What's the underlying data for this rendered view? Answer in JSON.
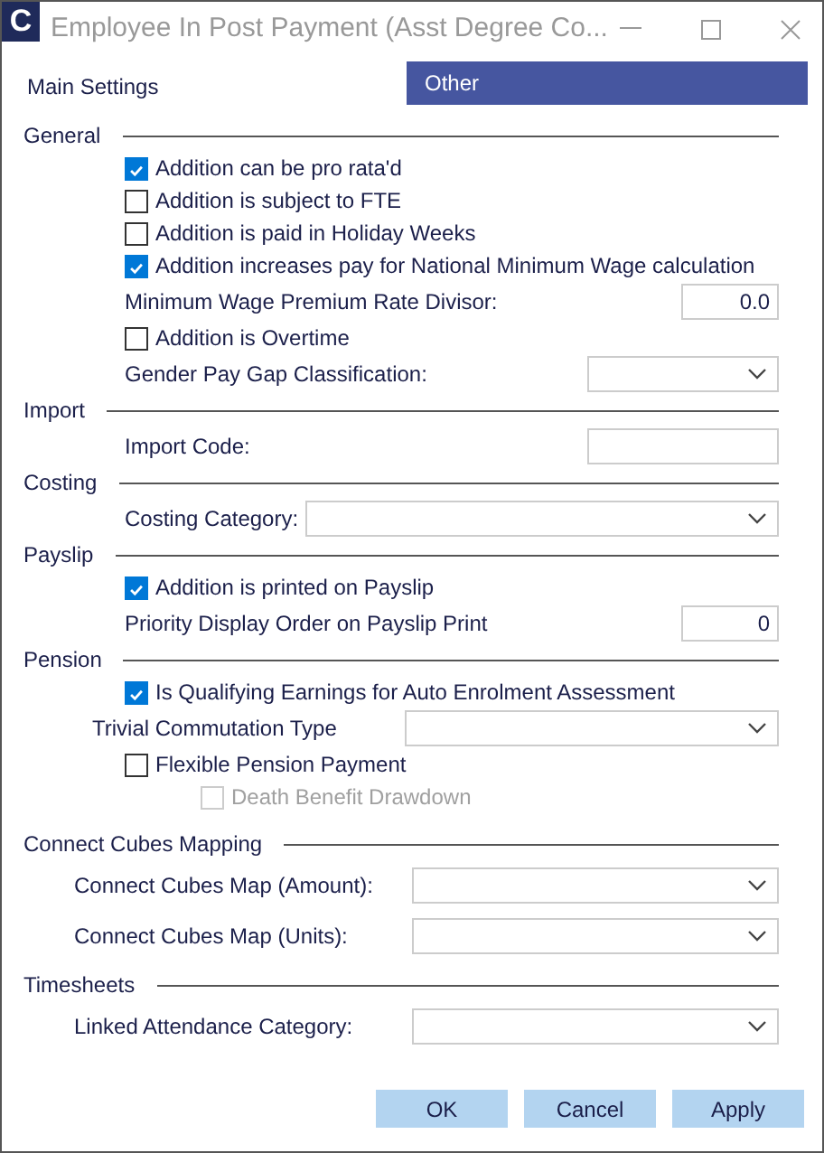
{
  "window": {
    "app_icon": "C",
    "title": "Employee In Post Payment (Asst Degree Co..."
  },
  "tabs": [
    {
      "label": "Main Settings",
      "selected": false
    },
    {
      "label": "Other",
      "selected": true
    }
  ],
  "sections": [
    {
      "title": "General",
      "rows": [
        {
          "kind": "checkbox",
          "label": "Addition can be pro rata'd",
          "checked": true,
          "disabled": false
        },
        {
          "kind": "checkbox",
          "label": "Addition is subject to FTE",
          "checked": false,
          "disabled": false
        },
        {
          "kind": "checkbox",
          "label": "Addition is paid in Holiday Weeks",
          "checked": false,
          "disabled": false
        },
        {
          "kind": "checkbox",
          "label": "Addition increases pay for National Minimum Wage calculation",
          "checked": true,
          "disabled": false
        },
        {
          "kind": "number",
          "label": "Minimum Wage Premium Rate Divisor:",
          "value": "0.0"
        },
        {
          "kind": "checkbox",
          "label": "Addition is Overtime",
          "checked": false,
          "disabled": false
        },
        {
          "kind": "dropdown",
          "label": "Gender Pay Gap Classification:"
        }
      ]
    },
    {
      "title": "Import",
      "rows": [
        {
          "kind": "text",
          "label": "Import Code:"
        }
      ]
    },
    {
      "title": "Costing",
      "rows": [
        {
          "kind": "dropdown",
          "label": "Costing Category:"
        }
      ]
    },
    {
      "title": "Payslip",
      "rows": [
        {
          "kind": "checkbox",
          "label": "Addition is printed on Payslip",
          "checked": true,
          "disabled": false
        },
        {
          "kind": "number",
          "label": "Priority Display Order on Payslip Print",
          "value": "0"
        }
      ]
    },
    {
      "title": "Pension",
      "rows": [
        {
          "kind": "checkbox",
          "label": "Is Qualifying Earnings for Auto Enrolment Assessment",
          "checked": true,
          "disabled": false
        },
        {
          "kind": "dropdown",
          "label": "Trivial Commutation Type"
        },
        {
          "kind": "checkbox",
          "label": "Flexible Pension Payment",
          "checked": false,
          "disabled": false,
          "children": [
            {
              "kind": "checkbox",
              "label": "Death Benefit Drawdown",
              "checked": false,
              "disabled": true
            }
          ]
        }
      ]
    },
    {
      "title": "Connect Cubes Mapping",
      "rows": [
        {
          "kind": "dropdown",
          "label": "Connect Cubes Map (Amount):"
        },
        {
          "kind": "dropdown",
          "label": "Connect Cubes Map (Units):"
        }
      ]
    },
    {
      "title": "Timesheets",
      "rows": [
        {
          "kind": "dropdown",
          "label": "Linked Attendance Category:"
        }
      ]
    }
  ],
  "buttons": [
    "OK",
    "Cancel",
    "Apply"
  ]
}
